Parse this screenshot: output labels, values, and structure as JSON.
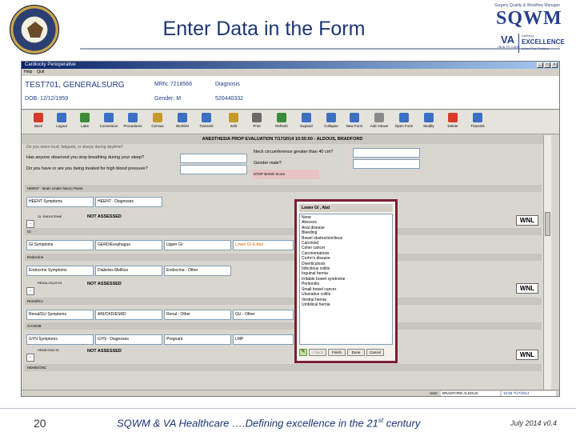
{
  "slide": {
    "title": "Enter Data in the Form",
    "number": "20",
    "footer_main": "SQWM & VA Healthcare ….Defining excellence in the 21",
    "footer_sup": "st",
    "footer_tail": " century",
    "footer_date": "July 2014  v0.4"
  },
  "logo": {
    "tagline": "Surgery Quality & Workflow Manager",
    "name": "SQWM",
    "va": "VA",
    "care": "HEALTH CARE",
    "defining": "Defining",
    "excellence": "EXCELLENCE",
    "century": "in the 21st Century"
  },
  "app": {
    "window_title": "Cardiocity Perioperative",
    "menu": [
      "Help",
      "Quit"
    ],
    "patient": {
      "name": "TEST701, GENERALSURG",
      "dob": "DOB: 12/12/1959",
      "mrn": "MRN: 7218566",
      "gender": "Gender: M",
      "diagnosis_label": "Diagnosis",
      "number": "520440332"
    },
    "toolbar": [
      {
        "label": "Back",
        "icon": "back-arrow-icon",
        "color": "#d83a2a"
      },
      {
        "label": "Logout",
        "icon": "logout-icon",
        "color": "#3a6fc4"
      },
      {
        "label": "Labs",
        "icon": "labs-icon",
        "color": "#3a8a3a"
      },
      {
        "label": "Conversion",
        "icon": "conversion-icon",
        "color": "#3a6fc4"
      },
      {
        "label": "Procedures",
        "icon": "procedures-icon",
        "color": "#3a6fc4"
      },
      {
        "label": "Census",
        "icon": "census-icon",
        "color": "#c49a2a"
      },
      {
        "label": "Worklist",
        "icon": "worklist-icon",
        "color": "#3a6fc4"
      },
      {
        "label": "Transmit",
        "icon": "transmit-icon",
        "color": "#3a6fc4"
      },
      {
        "label": "Edit",
        "icon": "edit-icon",
        "color": "#c49a2a"
      },
      {
        "label": "Print",
        "icon": "print-icon",
        "color": "#6a6a6a"
      },
      {
        "label": "Refresh",
        "icon": "refresh-icon",
        "color": "#3a8a3a"
      },
      {
        "label": "Expand",
        "icon": "expand-icon",
        "color": "#3a6fc4"
      },
      {
        "label": "Collapse",
        "icon": "collapse-icon",
        "color": "#3a6fc4"
      },
      {
        "label": "New Form",
        "icon": "new-form-icon",
        "color": "#3a6fc4"
      },
      {
        "label": "Add Viewer",
        "icon": "add-viewer-icon",
        "color": "#8a8a8a"
      },
      {
        "label": "Open Form",
        "icon": "open-form-icon",
        "color": "#3a6fc4"
      },
      {
        "label": "Modify",
        "icon": "modify-icon",
        "color": "#3a6fc4"
      },
      {
        "label": "Delete",
        "icon": "delete-icon",
        "color": "#d83a2a"
      },
      {
        "label": "Transmit",
        "icon": "transmit-icon",
        "color": "#3a6fc4"
      }
    ],
    "form": {
      "header": "ANESTHESIA PROP EVALUATION 7/17/2014 10:55:00  -  ALDOUS, BRADFORD",
      "partial_question": "Do you snore loud, fatigued, or sleepy during daytime?",
      "q_stop_breathing": "Has anyone observed you stop breathing during your sleep?",
      "q_blood_pressure": "Do you have or are you being treated for high blood pressure?",
      "q_neck": "Neck circumference greater than 40 cm?",
      "q_male": "Gender male?",
      "stop_bang": "STOP BANG Score",
      "heent_band": "HEENT - Brain Under Neuro Panel",
      "heent_symptoms": "HEENT Symptoms",
      "heent_diagnoses": "HEENT - Diagnoses",
      "gi_endocrine_sub": "GI, ENDOCRINE",
      "not_assessed_1": "NOT ASSESSED",
      "gi_band": "GI",
      "gi_symptoms": "GI Symptoms",
      "gerd": "GERD/Esophagus",
      "upper_gi": "Upper GI",
      "lower_gi": "Lower GI & Abd",
      "endocrine_band": "Endocrine",
      "endo_symptoms": "Endocrine Symptoms",
      "diabetes": "Diabetes Mellitus",
      "endo_other": "Endocrine - Other",
      "renal_sub": "RENAL/GU/GYN",
      "not_assessed_2": "NOT ASSESSED",
      "renal_band": "Renal/GU",
      "renal_symptoms": "Renal/GU Symptoms",
      "ari": "ARI/CKD/ESRD",
      "renal_other": "Renal - Other",
      "gu_other": "GU - Other",
      "gyn_band": "GYN/OB",
      "gyn_symptoms": "GYN Symptoms",
      "gyn_diagnoses": "GYN - Diagnoses",
      "pregnant": "Pregnant",
      "lmp": "LMP",
      "heme_sub": "HEME/ONC/ID",
      "not_assessed_3": "NOT ASSESSED",
      "hemeonc_band": "HEME/ONC",
      "toggle": "-",
      "wnl": "WNL"
    },
    "popup": {
      "title": "Lower GI , Abd",
      "items": [
        "None",
        "Abscess",
        "Anal disease",
        "Bleeding",
        "Bowel obstruction/ileus",
        "Carcinoid",
        "Colon cancer",
        "Carcinomatosis",
        "Crohn's disease",
        "Diverticulosis",
        "Infectious colitis",
        "Inguinal hernia",
        "Irritable bowel syndrome",
        "Peritonitis",
        "Small bowel cancer",
        "Ulcerative colitis",
        "Ventral hernia",
        "Umbilical hernia"
      ],
      "btn_back": "< Back",
      "btn_finish": "Finish",
      "btn_done": "Done",
      "btn_cancel": "Cancel",
      "pencil": "✎"
    },
    "status": {
      "user_label": "User:",
      "user_name": "BRADFORD ALDOUS",
      "datetime": "10:58  7/17/2014"
    }
  }
}
